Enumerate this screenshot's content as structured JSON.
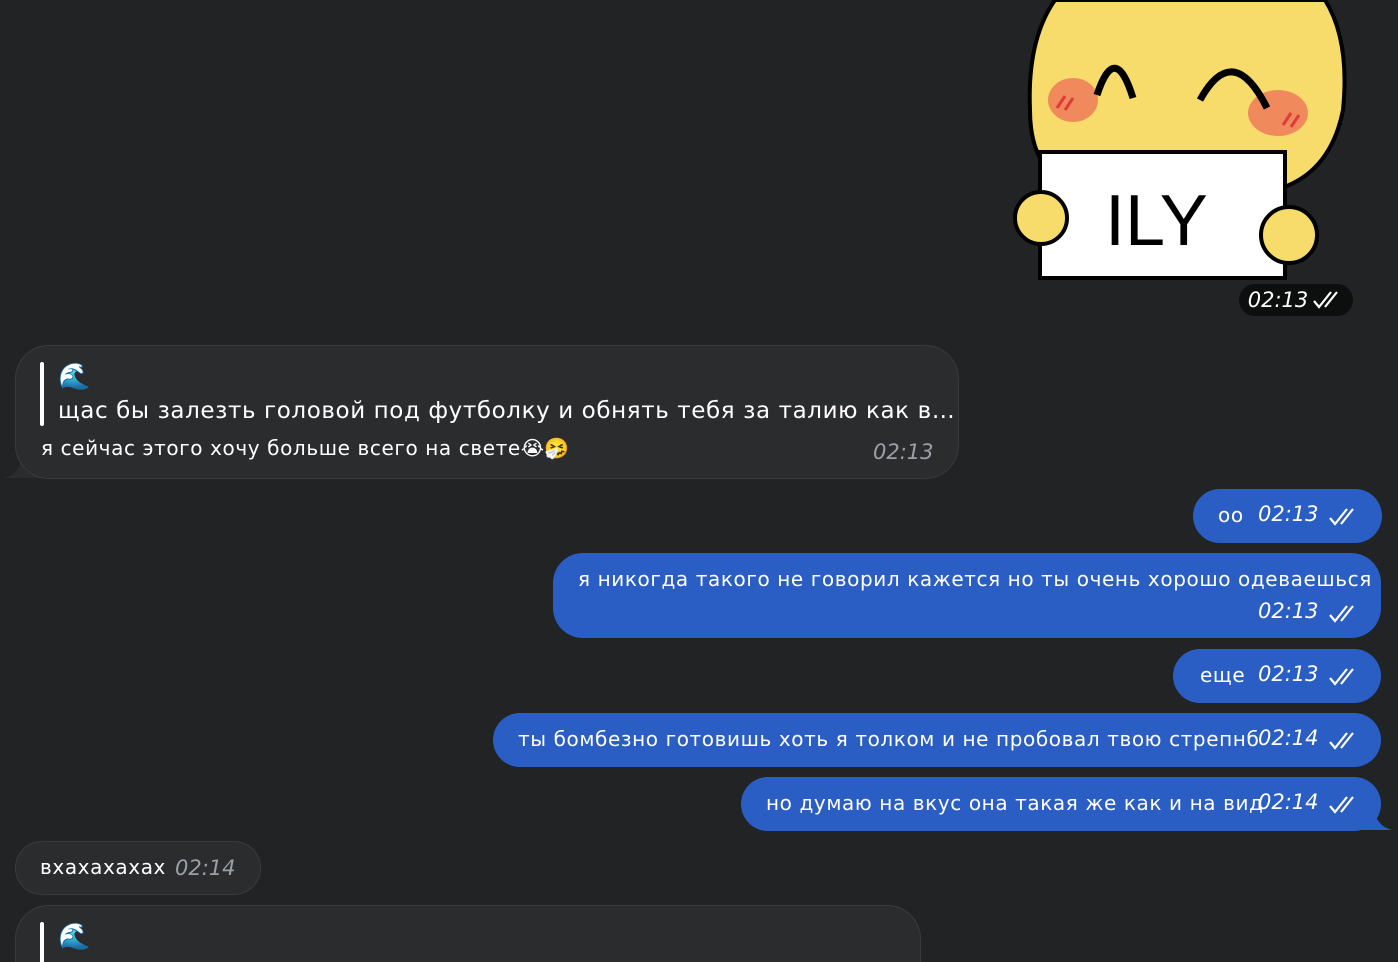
{
  "sticker": {
    "text": "ILY",
    "time": "02:13"
  },
  "messages": [
    {
      "reply_icon": "🌊",
      "reply_text": "щас бы залезть головой под футболку и обнять тебя за талию как в…",
      "text": "я сейчас этого хочу больше всего на свете",
      "emoji": "😭🤧",
      "time": "02:13"
    },
    {
      "text": "оо",
      "time": "02:13"
    },
    {
      "text": "я никогда такого не говорил кажется но ты очень хорошо одеваешься",
      "time": "02:13"
    },
    {
      "text": "еще",
      "time": "02:13"
    },
    {
      "text": "ты бомбезно готовишь хоть я толком и не пробовал твою стрепнб",
      "time": "02:14"
    },
    {
      "text": "но думаю на вкус она такая же как и на вид",
      "time": "02:14"
    },
    {
      "text": "вхахахахах",
      "time": "02:14"
    },
    {
      "reply_icon": "🌊"
    }
  ],
  "colors": {
    "background": "#212325",
    "incoming_bubble": "#2b2c2e",
    "outgoing_bubble": "#2a5ec4",
    "sticker_yellow": "#f7dc6b",
    "blush": "#f08a5d"
  },
  "icons": [
    "double-check-icon",
    "wave-emoji-icon",
    "sticker-ily-icon"
  ]
}
